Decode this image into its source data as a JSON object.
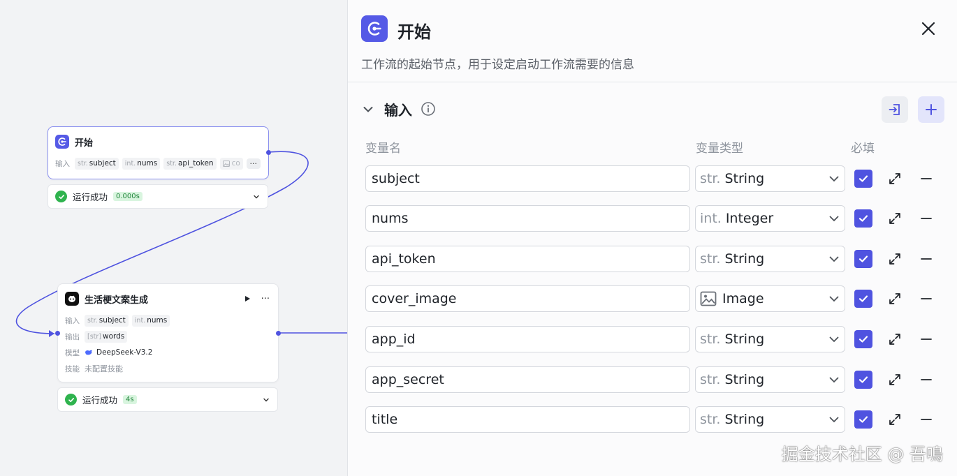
{
  "start_node": {
    "title": "开始",
    "input_label": "输入",
    "inputs": [
      {
        "type": "str.",
        "name": "subject"
      },
      {
        "type": "int.",
        "name": "nums"
      },
      {
        "type": "str.",
        "name": "api_token"
      },
      {
        "type": "image",
        "name": "co"
      }
    ],
    "more": "···",
    "status": {
      "text": "运行成功",
      "time": "0.000s"
    }
  },
  "llm_node": {
    "title": "生活梗文案生成",
    "more": "···",
    "input_label": "输入",
    "inputs": [
      {
        "type": "str.",
        "name": "subject"
      },
      {
        "type": "int.",
        "name": "nums"
      }
    ],
    "output_label": "输出",
    "outputs": [
      {
        "type": "[str]",
        "name": "words"
      }
    ],
    "model_label": "模型",
    "model": "DeepSeek-V3.2",
    "skill_label": "技能",
    "skill": "未配置技能",
    "status": {
      "text": "运行成功",
      "time": "4s"
    }
  },
  "panel": {
    "title": "开始",
    "description": "工作流的起始节点，用于设定启动工作流需要的信息",
    "section_title": "输入",
    "columns": {
      "name": "变量名",
      "type": "变量类型",
      "required": "必填"
    },
    "variables": [
      {
        "name": "subject",
        "type_prefix": "str.",
        "type": "String",
        "icon": "",
        "required": true
      },
      {
        "name": "nums",
        "type_prefix": "int.",
        "type": "Integer",
        "icon": "",
        "required": true
      },
      {
        "name": "api_token",
        "type_prefix": "str.",
        "type": "String",
        "icon": "",
        "required": true
      },
      {
        "name": "cover_image",
        "type_prefix": "",
        "type": "Image",
        "icon": "image-icon",
        "required": true
      },
      {
        "name": "app_id",
        "type_prefix": "str.",
        "type": "String",
        "icon": "",
        "required": true
      },
      {
        "name": "app_secret",
        "type_prefix": "str.",
        "type": "String",
        "icon": "",
        "required": true
      },
      {
        "name": "title",
        "type_prefix": "str.",
        "type": "String",
        "icon": "",
        "required": true
      }
    ]
  },
  "watermark": "掘金技术社区 @ 吾鳴",
  "colors": {
    "accent": "#4f53e0",
    "success": "#2fb34e",
    "edge": "#4f53e0"
  }
}
